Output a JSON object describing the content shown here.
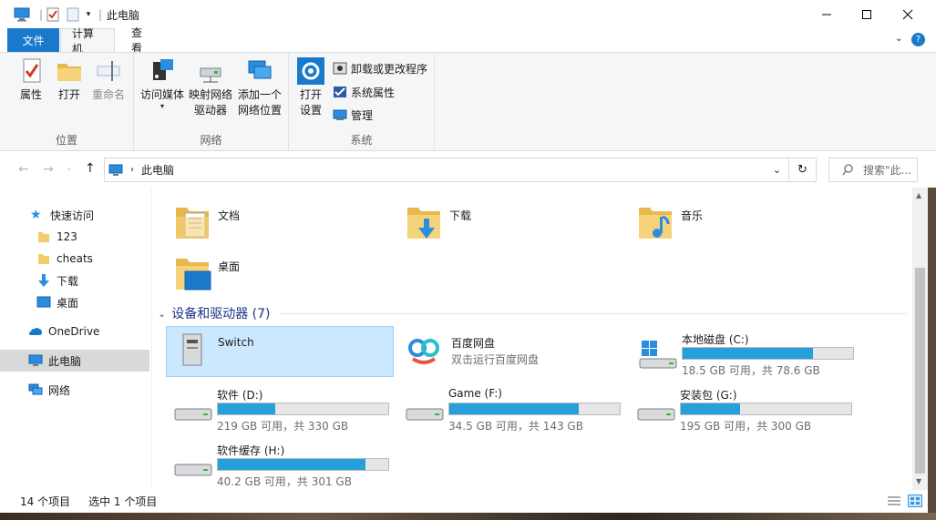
{
  "window": {
    "title": "此电脑"
  },
  "tabs": {
    "file": "文件",
    "computer": "计算机",
    "view": "查看"
  },
  "ribbon": {
    "location": {
      "label": "位置",
      "properties": "属性",
      "open": "打开",
      "rename": "重命名"
    },
    "network": {
      "label": "网络",
      "access_media": "访问媒体",
      "map_drive_line1": "映射网络",
      "map_drive_line2": "驱动器",
      "add_location_line1": "添加一个",
      "add_location_line2": "网络位置"
    },
    "system": {
      "label": "系统",
      "open_settings_line1": "打开",
      "open_settings_line2": "设置",
      "uninstall": "卸载或更改程序",
      "system_properties": "系统属性",
      "manage": "管理"
    }
  },
  "address": {
    "path": "此电脑",
    "search_placeholder": "搜索\"此..."
  },
  "nav": {
    "quick_access": "快速访问",
    "items": [
      "123",
      "cheats",
      "下载",
      "桌面"
    ],
    "onedrive": "OneDrive",
    "this_pc": "此电脑",
    "network": "网络"
  },
  "folders": [
    "文档",
    "下载",
    "音乐",
    "桌面"
  ],
  "devices_header": "设备和驱动器 (7)",
  "devices": {
    "switch": "Switch",
    "baidu_name": "百度网盘",
    "baidu_desc": "双击运行百度网盘",
    "c_name": "本地磁盘 (C:)",
    "c_info": "18.5 GB 可用，共 78.6 GB",
    "c_used": 0.765,
    "d_name": "软件 (D:)",
    "d_info": "219 GB 可用，共 330 GB",
    "d_used": 0.336,
    "f_name": "Game (F:)",
    "f_info": "34.5 GB 可用，共 143 GB",
    "f_used": 0.759,
    "g_name": "安装包 (G:)",
    "g_info": "195 GB 可用，共 300 GB",
    "g_used": 0.35,
    "h_name": "软件缓存 (H:)",
    "h_info": "40.2 GB 可用，共 301 GB",
    "h_used": 0.866
  },
  "status": {
    "count": "14 个项目",
    "selected": "选中 1 个项目"
  },
  "colors": {
    "accent": "#1979ca",
    "bar_fill": "#26a0da",
    "selection": "#cce8ff"
  }
}
